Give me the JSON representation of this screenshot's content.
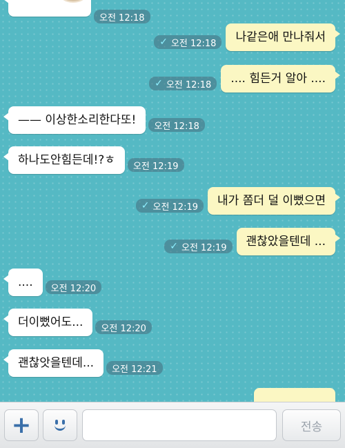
{
  "messages": [
    {
      "dir": "in",
      "text": "—— 이상한소리한다또!",
      "time": "오전 12:18",
      "read": false
    },
    {
      "dir": "in",
      "text": "하나도안힘든데!?ㅎ",
      "time": "오전 12:19",
      "read": false
    },
    {
      "dir": "out",
      "text": "나같은애 만나줘서",
      "time": "오전 12:18",
      "read": true
    },
    {
      "dir": "out",
      "text": ".... 힘든거 알아 ....",
      "time": "오전 12:18",
      "read": true
    },
    {
      "dir": "out",
      "text": "내가 쫌더 덜 이뻤으면",
      "time": "오전 12:19",
      "read": true
    },
    {
      "dir": "out",
      "text": "괜찮았을텐데 ...",
      "time": "오전 12:19",
      "read": true
    },
    {
      "dir": "in",
      "text": "....",
      "time": "오전 12:20",
      "read": false
    },
    {
      "dir": "in",
      "text": "더이뻤어도...",
      "time": "오전 12:20",
      "read": false
    },
    {
      "dir": "in",
      "text": "괜찮앗을텐데...",
      "time": "오전 12:21",
      "read": false
    }
  ],
  "top_partial": {
    "time": "오전 12:18"
  },
  "input": {
    "placeholder": "",
    "send_label": "전송"
  },
  "colors": {
    "background": "#55b9c4",
    "incoming_bubble": "#ffffff",
    "outgoing_bubble": "#fbf7c3",
    "read_check": "#8ff0ff"
  }
}
